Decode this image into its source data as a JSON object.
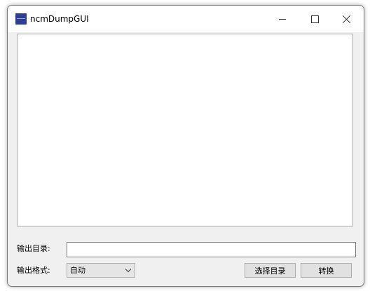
{
  "window": {
    "title": "ncmDumpGUI"
  },
  "form": {
    "output_dir_label": "输出目录:",
    "output_dir_value": "",
    "output_format_label": "输出格式:",
    "output_format_selected": "自动",
    "browse_button_label": "选择目录",
    "convert_button_label": "转换"
  },
  "icons": {
    "app": "app-icon",
    "minimize": "minimize-icon",
    "maximize": "maximize-icon",
    "close": "close-icon",
    "dropdown": "chevron-down-icon"
  }
}
